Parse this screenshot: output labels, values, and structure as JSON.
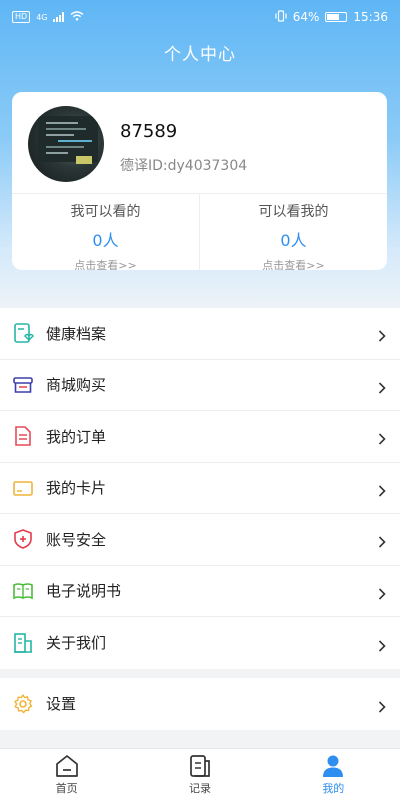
{
  "status_bar": {
    "left_badge": "HD",
    "network": "4G",
    "battery": "64%",
    "time": "15:36"
  },
  "page": {
    "title": "个人中心"
  },
  "profile": {
    "username": "87589",
    "user_id": "德译ID:dy4037304"
  },
  "stats": [
    {
      "label": "我可以看的",
      "count": "0人",
      "link": "点击查看>>"
    },
    {
      "label": "可以看我的",
      "count": "0人",
      "link": "点击查看>>"
    }
  ],
  "menu": [
    {
      "label": "健康档案",
      "icon": "health-record-icon",
      "color": "#26b5a6"
    },
    {
      "label": "商城购买",
      "icon": "store-icon",
      "color": "#3b3fa8"
    },
    {
      "label": "我的订单",
      "icon": "order-icon",
      "color": "#e94b58"
    },
    {
      "label": "我的卡片",
      "icon": "card-icon",
      "color": "#f0b43a"
    },
    {
      "label": "账号安全",
      "icon": "shield-icon",
      "color": "#e23b4b"
    },
    {
      "label": "电子说明书",
      "icon": "manual-icon",
      "color": "#4dbb3a"
    },
    {
      "label": "关于我们",
      "icon": "building-icon",
      "color": "#26b5a6"
    }
  ],
  "settings": {
    "label": "设置",
    "icon": "gear-icon",
    "color": "#f0b43a"
  },
  "tabbar": {
    "tabs": [
      {
        "label": "首页",
        "icon": "home-icon"
      },
      {
        "label": "记录",
        "icon": "record-icon"
      },
      {
        "label": "我的",
        "icon": "profile-icon",
        "active": true
      }
    ],
    "active_color": "#2f8ff0"
  }
}
